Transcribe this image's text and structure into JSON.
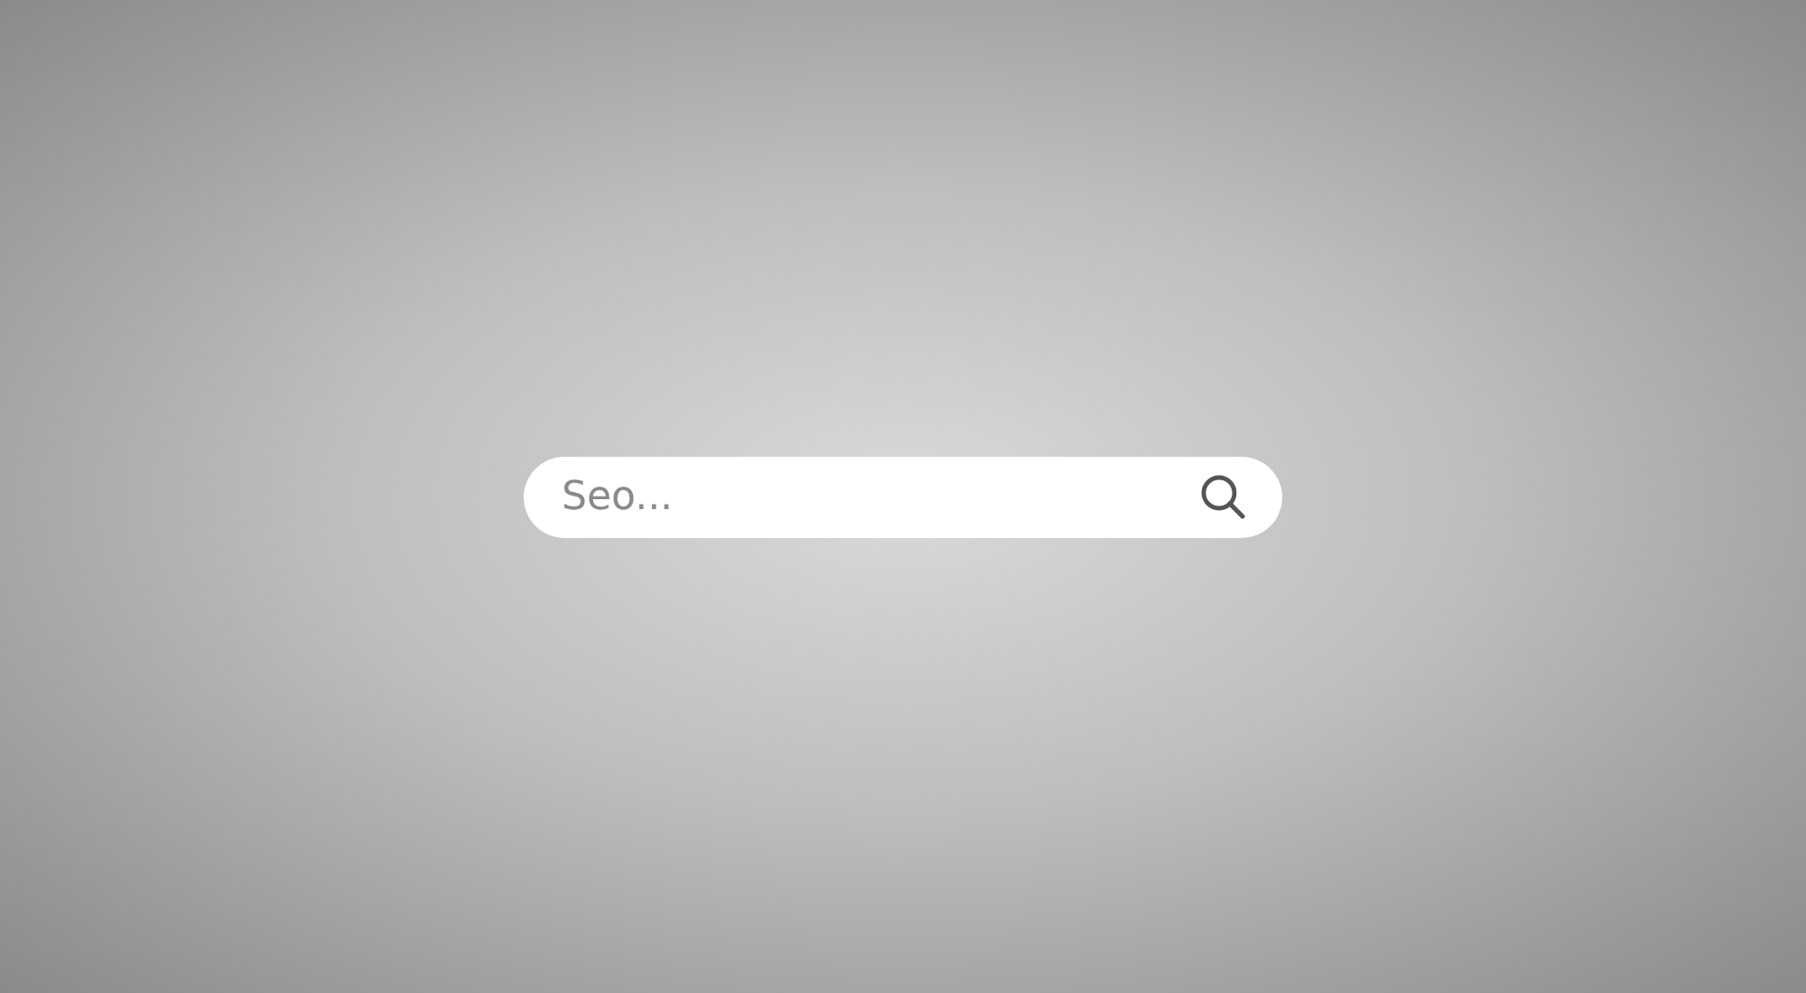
{
  "search": {
    "placeholder": "Seo..."
  }
}
